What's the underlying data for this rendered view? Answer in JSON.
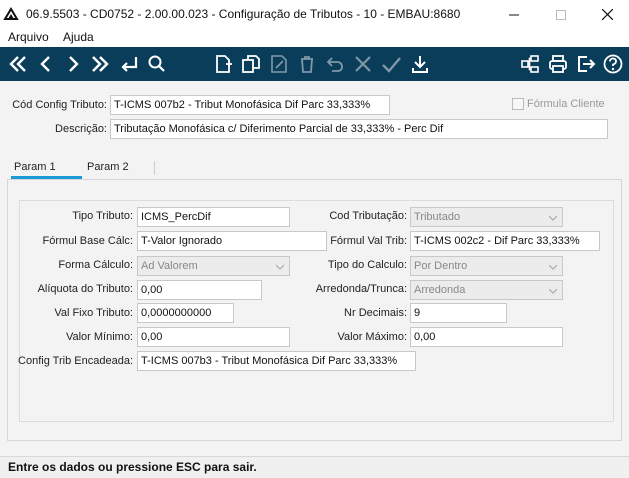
{
  "window": {
    "title": "06.9.5503 - CD0752 - 2.00.00.023 - Configuração de Tributos - 10 - EMBAU:8680"
  },
  "menu": {
    "items": [
      "Arquivo",
      "Ajuda"
    ]
  },
  "toolbar": {
    "icons": [
      "first-record-icon",
      "previous-record-icon",
      "next-record-icon",
      "last-record-icon",
      "enter-icon",
      "search-icon",
      "new-document-icon",
      "copy-icon",
      "edit-icon",
      "delete-icon",
      "undo-icon",
      "cancel-icon",
      "confirm-icon",
      "download-icon",
      "structure-icon",
      "print-icon",
      "exit-icon",
      "help-icon"
    ],
    "accent": "#0a3d5a"
  },
  "header": {
    "cod_label": "Cód Config Tributo:",
    "cod_value": "T-ICMS 007b2 - Tribut Monofásica Dif Parc 33,333%",
    "formula_cliente_label": "Fórmula Cliente",
    "descricao_label": "Descrição:",
    "descricao_value": "Tributação Monofásica c/ Diferimento Parcial de 33,333% - Perc Dif"
  },
  "tabs": [
    {
      "label": "Param 1",
      "active": true
    },
    {
      "label": "Param 2",
      "active": false
    }
  ],
  "form": {
    "tipo_tributo": {
      "label": "Tipo Tributo:",
      "value": "ICMS_PercDif"
    },
    "cod_tributacao": {
      "label": "Cod Tributação:",
      "value": "Tributado"
    },
    "formul_base_calc": {
      "label": "Fórmul Base Cálc:",
      "value": "T-Valor Ignorado"
    },
    "formul_val_trib": {
      "label": "Fórmul Val Trib:",
      "value": "T-ICMS 002c2 - Dif Parc 33,333%"
    },
    "forma_calculo": {
      "label": "Forma Cálculo:",
      "value": "Ad Valorem"
    },
    "tipo_calculo": {
      "label": "Tipo do Calculo:",
      "value": "Por Dentro"
    },
    "aliquota": {
      "label": "Alíquota do Tributo:",
      "value": "0,00"
    },
    "arredonda": {
      "label": "Arredonda/Trunca:",
      "value": "Arredonda"
    },
    "val_fixo": {
      "label": "Val Fixo Tributo:",
      "value": "0,0000000000"
    },
    "nr_decimais": {
      "label": "Nr Decimais:",
      "value": "9"
    },
    "valor_minimo": {
      "label": "Valor Mínimo:",
      "value": "0,00"
    },
    "valor_maximo": {
      "label": "Valor Máximo:",
      "value": "0,00"
    },
    "config_encadeada": {
      "label": "Config Trib Encadeada:",
      "value": "T-ICMS 007b3 - Tribut Monofásica Dif Parc 33,333%"
    }
  },
  "status": {
    "text": "Entre os dados ou pressione ESC para sair."
  }
}
